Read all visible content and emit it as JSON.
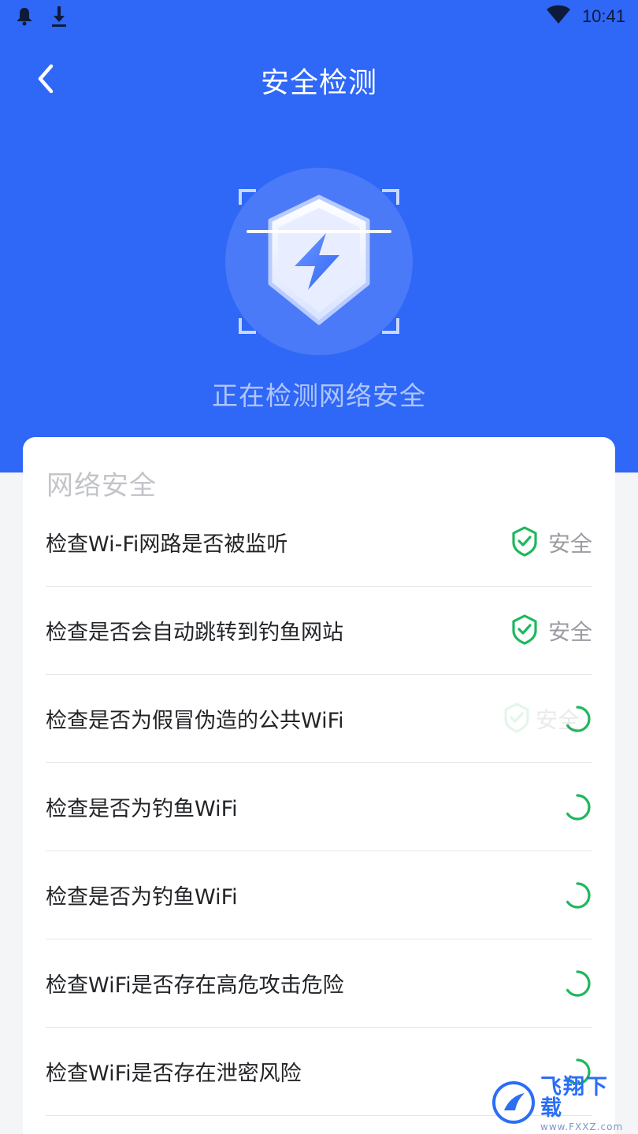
{
  "status_bar": {
    "time": "10:41",
    "left_icons": [
      "bell-icon",
      "download-icon"
    ],
    "right_icons": [
      "wifi-icon"
    ]
  },
  "header": {
    "title": "安全检测",
    "back_icon": "chevron-left-icon"
  },
  "scanner": {
    "icon": "shield-lightning-icon",
    "caption": "正在检测网络安全"
  },
  "card": {
    "title": "网络安全",
    "items": [
      {
        "label": "检查Wi-Fi网路是否被监听",
        "status": "safe",
        "status_text": "安全"
      },
      {
        "label": "检查是否会自动跳转到钓鱼网站",
        "status": "safe",
        "status_text": "安全"
      },
      {
        "label": "检查是否为假冒伪造的公共WiFi",
        "status": "checking",
        "status_text": "安全"
      },
      {
        "label": "检查是否为钓鱼WiFi",
        "status": "checking",
        "status_text": ""
      },
      {
        "label": "检查是否为钓鱼WiFi",
        "status": "checking",
        "status_text": ""
      },
      {
        "label": "检查WiFi是否存在高危攻击危险",
        "status": "checking",
        "status_text": ""
      },
      {
        "label": "检查WiFi是否存在泄密风险",
        "status": "checking",
        "status_text": ""
      }
    ]
  },
  "watermark": {
    "main": "飞翔下载",
    "sub": "www.FXXZ.com"
  },
  "colors": {
    "primary": "#2f67f6",
    "safe_green": "#1fb85c",
    "muted_text": "#9a9ca1"
  }
}
